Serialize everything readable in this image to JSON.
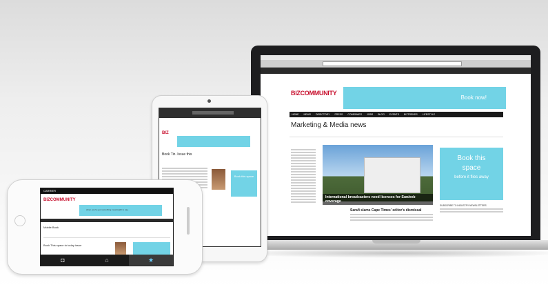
{
  "laptop": {
    "logo": "BIZCOMMUNITY",
    "banner_text": "Book now!",
    "nav_items": [
      "HOME",
      "NEWS",
      "DIRECTORY",
      "PRESS",
      "COMPANIES",
      "JOBS",
      "BLOG",
      "EVENTS",
      "BIZTRENDS",
      "LIFESTYLE"
    ],
    "title": "Marketing & Media news",
    "ad_line1": "Book this",
    "ad_line2": "space",
    "ad_line3": "before it flies away",
    "headline": "International broadcasters need licences for Sun/eeb coverage",
    "subscribe_label": "SUBSCRIBE TO INDUSTRY NEWSLETTERS",
    "article_title": "Sarafi slams Cape Times' editor's dismissal"
  },
  "tablet": {
    "logo": "BIZ",
    "title": "Book Tin. Issue this",
    "ad_text": "Book this space"
  },
  "phone": {
    "status_carrier": "CARRIER",
    "logo": "BIZCOMMUNITY",
    "banner_text": "when you've got something meaningful to say...",
    "title": "Mobile Book",
    "headline": "Book This space to today issue",
    "tabs": [
      {
        "icon": "camera-icon",
        "glyph": "⌂"
      },
      {
        "icon": "home-icon",
        "glyph": "⌂"
      },
      {
        "icon": "star-icon",
        "glyph": "★"
      }
    ]
  },
  "colors": {
    "accent": "#72d3e6",
    "brand": "#c8102e"
  }
}
